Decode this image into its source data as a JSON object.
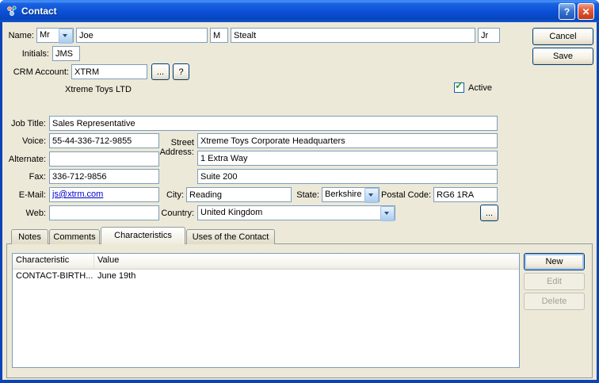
{
  "window": {
    "title": "Contact"
  },
  "icons": {
    "help": "?",
    "close": "✕",
    "checkmark": "✓"
  },
  "actions": {
    "cancel": "Cancel",
    "save": "Save"
  },
  "form": {
    "name": {
      "label": "Name:",
      "prefix": "Mr",
      "first": "Joe",
      "middle": "M",
      "last": "Stealt",
      "suffix": "Jr"
    },
    "initials": {
      "label": "Initials:",
      "value": "JMS"
    },
    "crm_account": {
      "label": "CRM Account:",
      "value": "XTRM",
      "browse_label": "...",
      "help_label": "?",
      "display_name": "Xtreme Toys LTD"
    },
    "active": {
      "label": "Active",
      "checked": true
    },
    "job_title": {
      "label": "Job Title:",
      "value": "Sales Representative"
    },
    "voice": {
      "label": "Voice:",
      "value": "55-44-336-712-9855"
    },
    "alternate": {
      "label": "Alternate:",
      "value": ""
    },
    "fax": {
      "label": "Fax:",
      "value": "336-712-9856"
    },
    "email": {
      "label": "E-Mail:",
      "value": "js@xtrm.com"
    },
    "web": {
      "label": "Web:",
      "value": ""
    },
    "street_address": {
      "label": "Street Address:",
      "line1": "Xtreme Toys Corporate Headquarters",
      "line2": "1 Extra Way",
      "line3": "Suite 200"
    },
    "city": {
      "label": "City:",
      "value": "Reading"
    },
    "state": {
      "label": "State:",
      "value": "Berkshire"
    },
    "postal_code": {
      "label": "Postal Code:",
      "value": "RG6 1RA"
    },
    "country": {
      "label": "Country:",
      "value": "United Kingdom",
      "browse_label": "..."
    }
  },
  "tabs": [
    {
      "label": "Notes",
      "active": false
    },
    {
      "label": "Comments",
      "active": false
    },
    {
      "label": "Characteristics",
      "active": true
    },
    {
      "label": "Uses of the Contact",
      "active": false
    }
  ],
  "characteristics": {
    "columns": [
      "Characteristic",
      "Value"
    ],
    "rows": [
      {
        "characteristic": "CONTACT-BIRTH...",
        "value": "June 19th"
      }
    ],
    "buttons": {
      "new": "New",
      "edit": "Edit",
      "delete": "Delete"
    }
  },
  "colors": {
    "frame": "#0C43B8",
    "dialog_bg": "#ECE9D8",
    "input_border": "#7F9DB9",
    "link": "#0000CC",
    "check_green": "#21A121"
  }
}
